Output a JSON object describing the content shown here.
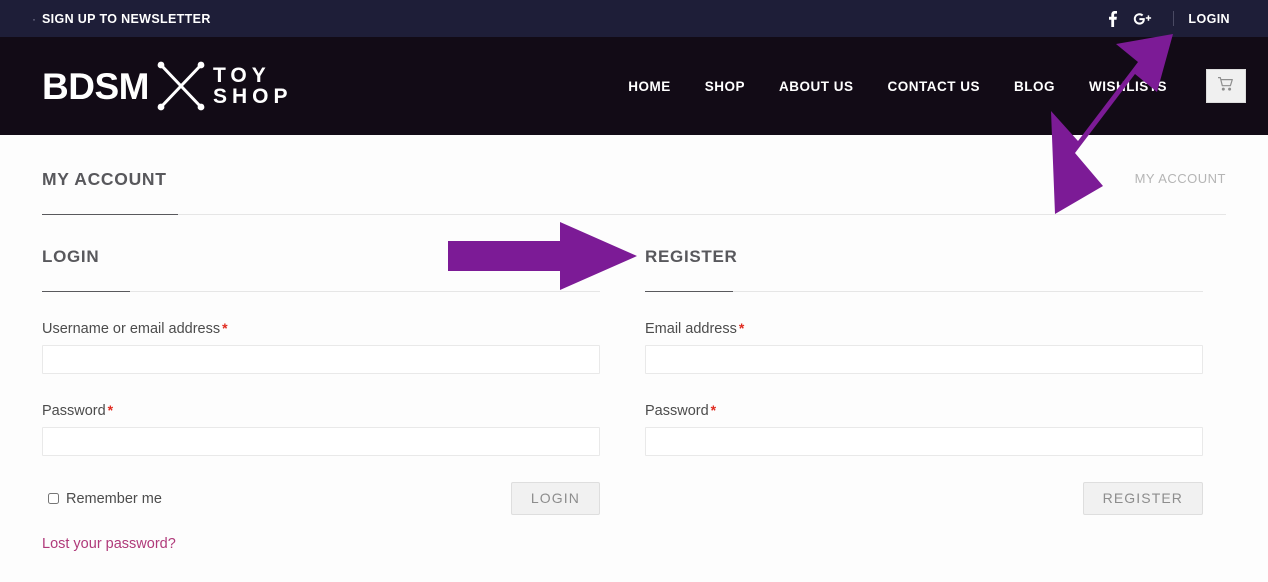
{
  "topbar": {
    "bullet": "·",
    "newsletter": "SIGN UP TO NEWSLETTER",
    "social": [
      {
        "name": "facebook-icon",
        "label": "f"
      },
      {
        "name": "google-plus-icon",
        "label": "G+"
      }
    ],
    "login": "LOGIN"
  },
  "header": {
    "logo": {
      "brand": "BDSM",
      "mark": "x-crossed-crops-icon",
      "word_top": "TOY",
      "word_bottom": "SHOP"
    },
    "nav": [
      {
        "label": "HOME",
        "name": "nav-home"
      },
      {
        "label": "SHOP",
        "name": "nav-shop"
      },
      {
        "label": "ABOUT US",
        "name": "nav-about-us"
      },
      {
        "label": "CONTACT US",
        "name": "nav-contact-us"
      },
      {
        "label": "BLOG",
        "name": "nav-blog"
      },
      {
        "label": "WISHLISTS",
        "name": "nav-wishlists"
      }
    ],
    "cart_icon": "shopping-cart-icon"
  },
  "page": {
    "title": "MY ACCOUNT",
    "breadcrumb": "MY ACCOUNT"
  },
  "login_panel": {
    "title": "LOGIN",
    "username": {
      "label": "Username or email address",
      "required_mark": "*",
      "value": "",
      "placeholder": ""
    },
    "password": {
      "label": "Password",
      "required_mark": "*",
      "value": "",
      "placeholder": ""
    },
    "remember_label": "Remember me",
    "remember_checked": false,
    "submit_label": "LOGIN",
    "lost_password": "Lost your password?"
  },
  "register_panel": {
    "title": "REGISTER",
    "email": {
      "label": "Email address",
      "required_mark": "*",
      "value": "",
      "placeholder": ""
    },
    "password": {
      "label": "Password",
      "required_mark": "*",
      "value": "",
      "placeholder": ""
    },
    "submit_label": "REGISTER"
  },
  "annotations": {
    "accent_color": "#7c1b96",
    "arrows": [
      {
        "name": "arrow-pointing-to-register",
        "direction": "right"
      },
      {
        "name": "arrow-pointing-to-login-link",
        "direction": "up-right"
      }
    ]
  },
  "colors": {
    "topbar_bg": "#1e1e38",
    "header_bg": "#120b16",
    "page_bg": "#fdfdfd",
    "accent_purple": "#7c1b96",
    "link_pink": "#b03a7a",
    "required_red": "#e02b20",
    "heading_gray": "#58585c"
  }
}
